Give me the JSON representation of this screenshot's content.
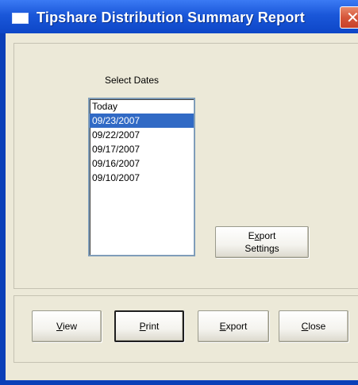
{
  "window": {
    "title": "Tipshare Distribution Summary Report",
    "close_glyph": "✕",
    "titlebar_color": "#1a57d9",
    "close_color": "#d5563a",
    "background": "#ece9d8"
  },
  "dates": {
    "label": "Select Dates",
    "items": [
      "Today",
      "09/23/2007",
      "09/22/2007",
      "09/17/2007",
      "09/16/2007",
      "09/10/2007"
    ],
    "selected_index": 1,
    "selected_color": "#316ac5"
  },
  "export_settings": {
    "line1_mnemonic": "x",
    "line1_prefix": "E",
    "line1_suffix": "port",
    "line2": "Settings"
  },
  "buttons": {
    "view": {
      "mnemonic": "V",
      "rest": "iew"
    },
    "print": {
      "mnemonic": "P",
      "rest": "rint"
    },
    "export": {
      "mnemonic": "E",
      "rest": "xport"
    },
    "close": {
      "mnemonic": "C",
      "rest": "lose"
    }
  }
}
